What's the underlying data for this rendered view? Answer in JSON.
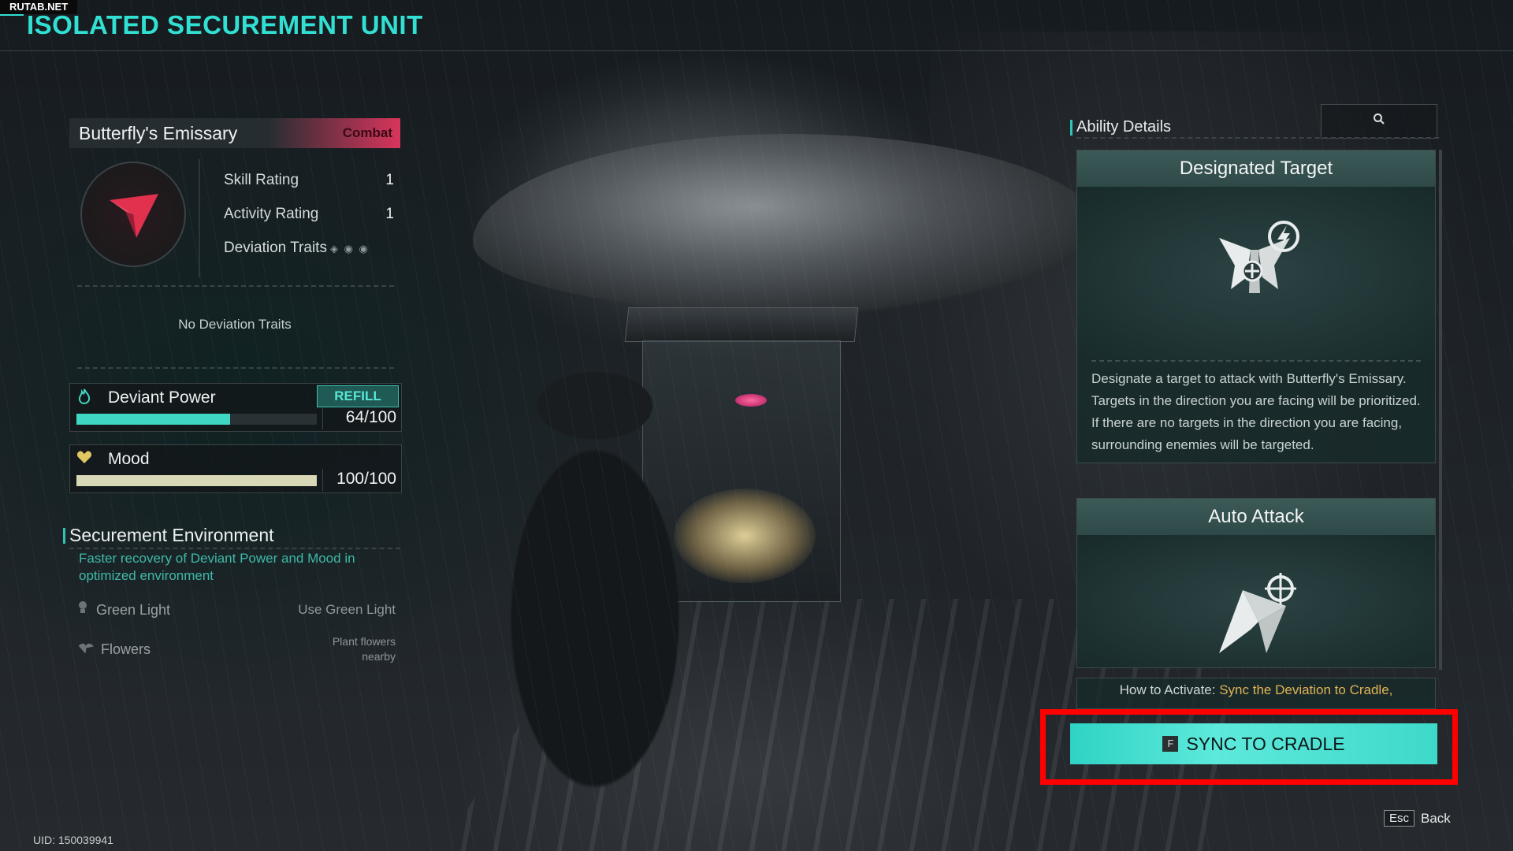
{
  "watermark": "RUTAB.NET",
  "header": {
    "title": "ISOLATED SECUREMENT UNIT"
  },
  "deviation": {
    "name": "Butterfly's Emissary",
    "type_tag": "Combat",
    "stats": [
      {
        "label": "Skill Rating",
        "value": "1"
      },
      {
        "label": "Activity Rating",
        "value": "1"
      },
      {
        "label": "Deviation Traits",
        "value": ""
      }
    ],
    "traits_text": "No Deviation Traits"
  },
  "meters": {
    "deviant_power": {
      "label": "Deviant Power",
      "refill": "REFILL",
      "value_text": "64/100",
      "fraction": 0.64,
      "color": "#3fd6c3"
    },
    "mood": {
      "label": "Mood",
      "value_text": "100/100",
      "fraction": 1.0,
      "color": "#d8d7b6"
    }
  },
  "environment": {
    "title": "Securement Environment",
    "description": "Faster recovery of Deviant Power and Mood in optimized environment",
    "items": [
      {
        "name": "Green Light",
        "requirement": "Use Green Light",
        "icon": "bulb-icon"
      },
      {
        "name": "Flowers",
        "requirement_line1": "Plant flowers",
        "requirement_line2": "nearby",
        "icon": "flower-icon"
      }
    ]
  },
  "ability_panel": {
    "heading": "Ability Details",
    "search_icon": "search-icon",
    "cards": [
      {
        "title": "Designated Target",
        "description": "Designate a target to attack with Butterfly's Emissary. Targets in the direction you are facing will be prioritized. If there are no targets in the direction you are facing, surrounding enemies will be targeted."
      },
      {
        "title": "Auto Attack"
      }
    ],
    "how_to_label": "How to Activate:",
    "how_to_text": "Sync the Deviation to Cradle,"
  },
  "actions": {
    "sync_key": "F",
    "sync_label": "SYNC TO CRADLE",
    "back_key": "Esc",
    "back_label": "Back"
  },
  "footer": {
    "uid": "UID: 150039941"
  },
  "colors": {
    "accent": "#31e0d2",
    "combat_tag": "#d9355c",
    "highlight": "#ff0000"
  }
}
